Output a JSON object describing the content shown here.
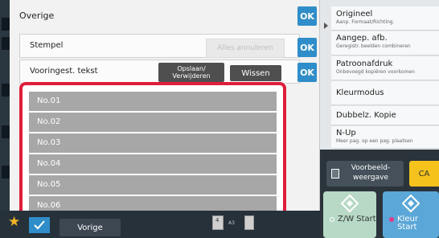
{
  "dialog": {
    "title": "Overige",
    "ok_label": "OK",
    "stempel": {
      "label": "Stempel",
      "cancel_all": "Alles annuleren",
      "ok_label": "OK"
    },
    "preset": {
      "label": "Vooringest. tekst",
      "save_delete": "Opslaan/ Verwijderen",
      "wissen": "Wissen",
      "ok_label": "OK"
    },
    "items": [
      "No.01",
      "No.02",
      "No.03",
      "No.04",
      "No.05",
      "No.06"
    ]
  },
  "sidebar": {
    "items": [
      {
        "title": "Origineel",
        "sub": "Aanp. Formaat/Richting."
      },
      {
        "title": "Aangep. afb.",
        "sub": "Geregistr. beelden combineren"
      },
      {
        "title": "Patroonafdruk",
        "sub": "Onbevoegd kopiëren voorkomen"
      },
      {
        "title": "Kleurmodus",
        "sub": ""
      },
      {
        "title": "Dubbelz. Kopie",
        "sub": ""
      },
      {
        "title": "N-Up",
        "sub": "Meer pag. op een pag. plaatsen"
      }
    ],
    "preview_label": "Voorbeeld-weergave",
    "ca_label": "CA",
    "bw_start": "Z/W Start",
    "color_start": "Kleur Start"
  },
  "bottom": {
    "back_label": "Vorige",
    "paper_size": "A3",
    "paper_count": "4"
  },
  "colors": {
    "accent": "#2f8dc9",
    "highlight": "#dd1f3b",
    "ca": "#f4c21b",
    "bw_start": "#b7d9c5",
    "color_start": "#5aa7d8"
  }
}
